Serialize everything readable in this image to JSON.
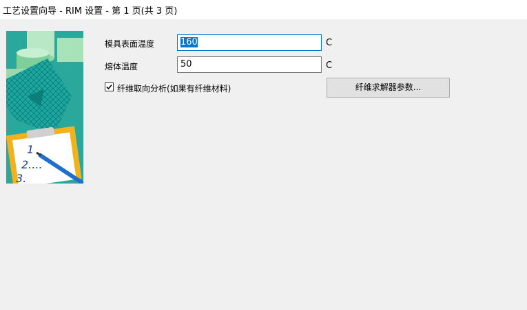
{
  "window": {
    "title": "工艺设置向导 - RIM 设置 - 第 1 页(共 3 页)"
  },
  "wizard_image": {
    "steps": [
      "1",
      "2....",
      "3."
    ]
  },
  "form": {
    "mold_temp": {
      "label": "模具表面温度",
      "value": "160",
      "unit": "C"
    },
    "melt_temp": {
      "label": "熔体温度",
      "value": "50",
      "unit": "C"
    },
    "fiber_analysis": {
      "label": "纤维取向分析(如果有纤维材料)",
      "checked": true
    },
    "fiber_solver_button": {
      "label": "纤维求解器参数..."
    }
  },
  "colors": {
    "accent": "#0078d7",
    "background": "#f0f0f0"
  }
}
